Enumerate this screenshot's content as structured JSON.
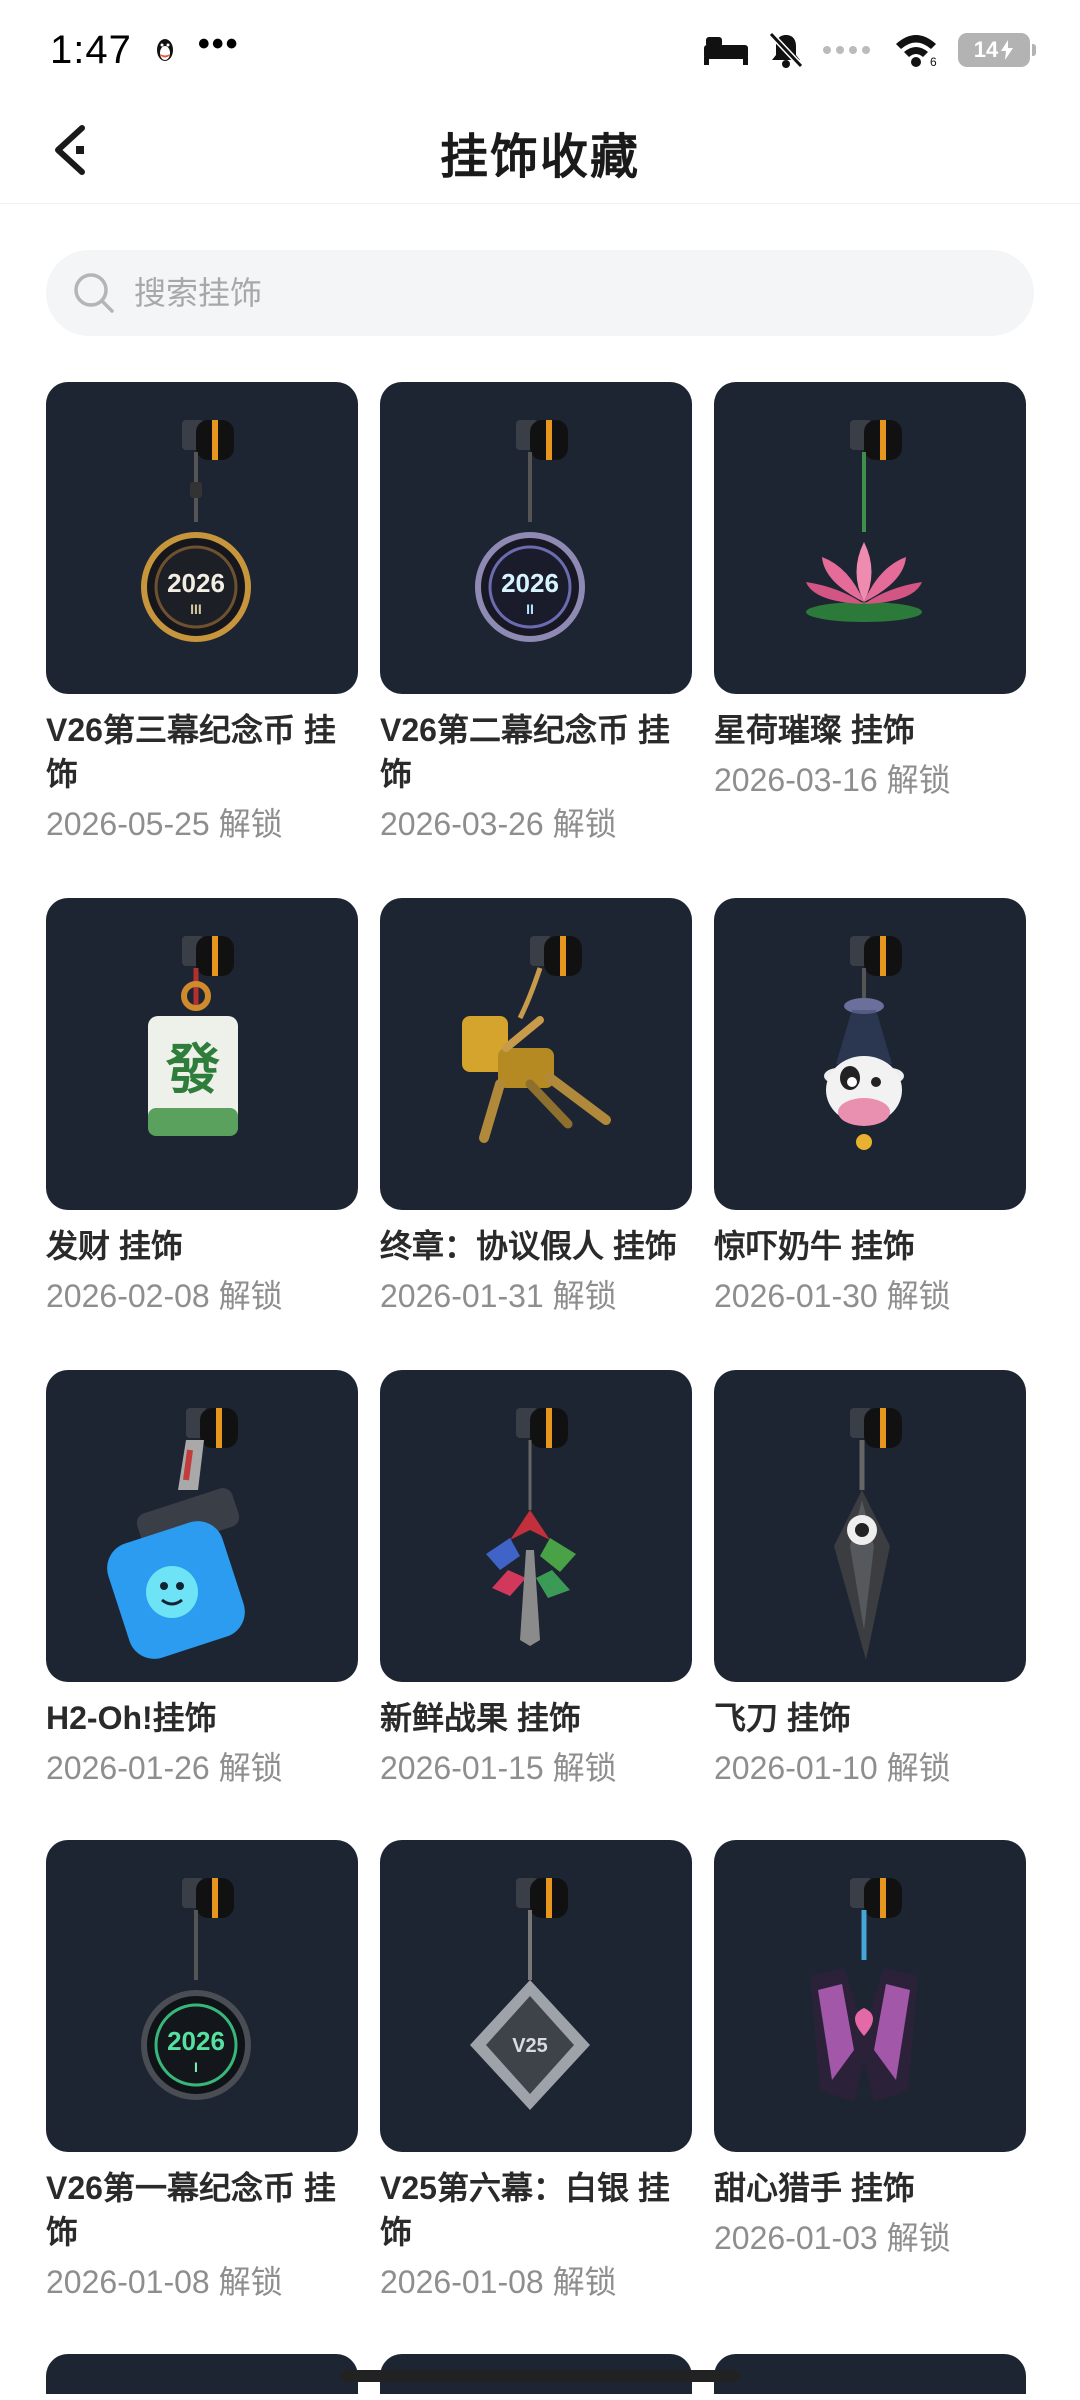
{
  "status": {
    "time": "1:47",
    "dots": "•••",
    "battery": "14"
  },
  "header": {
    "title": "挂饰收藏"
  },
  "search": {
    "placeholder": "搜索挂饰"
  },
  "items": [
    {
      "name": "V26第三幕纪念币 挂饰",
      "date": "2026-05-25 解锁",
      "icon": "coin-2026-iii-charm"
    },
    {
      "name": "V26第二幕纪念币 挂饰",
      "date": "2026-03-26 解锁",
      "icon": "coin-2026-ii-charm"
    },
    {
      "name": "星荷璀璨 挂饰",
      "date": "2026-03-16 解锁",
      "icon": "lotus-charm"
    },
    {
      "name": "发财 挂饰",
      "date": "2026-02-08 解锁",
      "icon": "mahjong-charm"
    },
    {
      "name": "终章：协议假人 挂饰",
      "date": "2026-01-31 解锁",
      "icon": "dummy-charm"
    },
    {
      "name": "惊吓奶牛 挂饰",
      "date": "2026-01-30 解锁",
      "icon": "cow-charm"
    },
    {
      "name": "H2-Oh!挂饰",
      "date": "2026-01-26 解锁",
      "icon": "bottle-charm"
    },
    {
      "name": "新鲜战果 挂饰",
      "date": "2026-01-15 解锁",
      "icon": "leaf-charm"
    },
    {
      "name": "飞刀 挂饰",
      "date": "2026-01-10 解锁",
      "icon": "knife-charm"
    },
    {
      "name": "V26第一幕纪念币 挂饰",
      "date": "2026-01-08 解锁",
      "icon": "coin-2026-i-charm"
    },
    {
      "name": "V25第六幕：白银 挂饰",
      "date": "2026-01-08 解锁",
      "icon": "silver-diamond-charm"
    },
    {
      "name": "甜心猎手 挂饰",
      "date": "2026-01-03 解锁",
      "icon": "heart-charm"
    }
  ],
  "coin_labels": {
    "c1": "2026",
    "c1_sub": "III",
    "c2": "2026",
    "c2_sub": "II",
    "c3": "2026",
    "c3_sub": "I",
    "mahjong": "發",
    "v25": "V25"
  },
  "colors": {
    "card_bg": "#1d2533",
    "accent_orange": "#e8951e",
    "text_secondary": "#8e8e8e"
  }
}
